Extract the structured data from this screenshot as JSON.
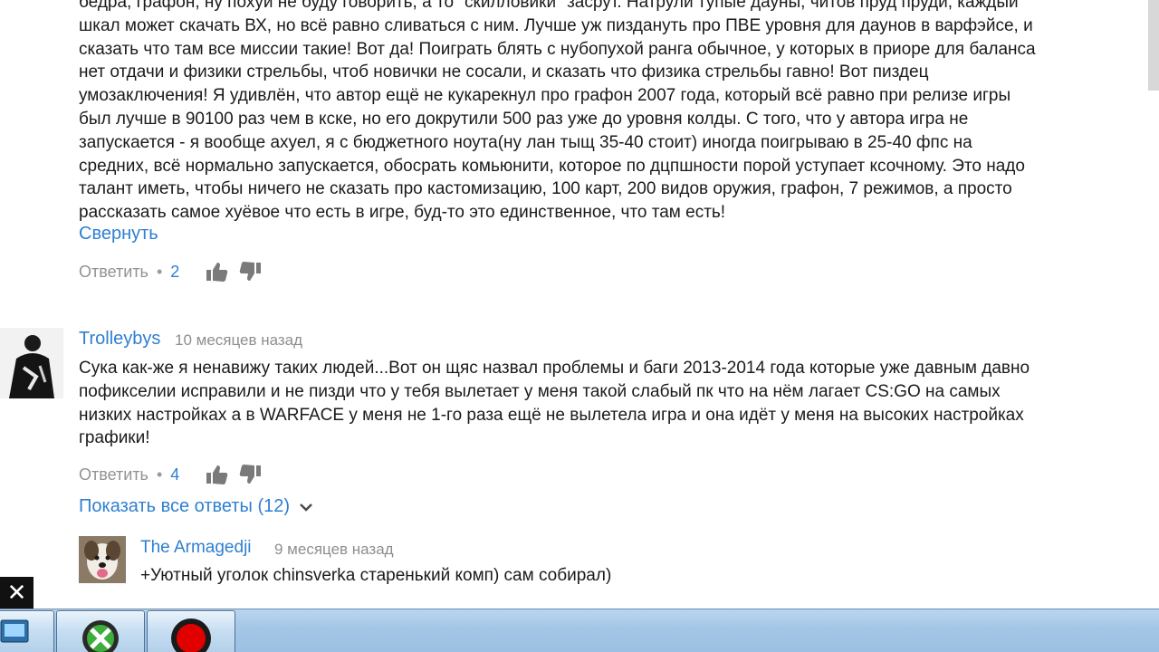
{
  "comment1": {
    "text": "бедра, графон, ну похуй не буду говорить, а то \"скилловики\" засрут. Натрули тупые дауны, читов пруд пруди, каждый\nшкал может скачать ВХ, но всё равно сливаться с ним. Лучше уж пиздануть про ПВЕ уровня для даунов в варфэйсе, и\nсказать что там все миссии такие! Вот да! Поиграть блять с нубопухой ранга обычное, у которых в приоре для баланса\nнет отдачи и физики стрельбы, чтоб новички не сосали, и сказать что физика стрельбы гавно! Вот пиздец\nумозаключения! Я удивлён, что автор ещё не кукарекнул про графон 2007 года, который всё равно при релизе игры\nбыл лучше в 90100 раз чем в кске, но его докрутили 500 раз уже до уровня колды. С того, что у автора игра не\nзапускается - я вообще ахуел, я с бюджетного ноута(ну лан тыщ 35-40 стоит) иногда поигрываю в 25-40 фпс на\nсредних, всё нормально запускается, обосрать комьюнити, которое по дцпшности порой уступает ксочному. Это надо\nталант иметь, чтобы ничего не сказать про кастомизацию, 100 карт, 200 видов оружия, графон, 7 режимов, а просто\nрассказать самое хуёвое что есть в игре, буд-то это единственное, что там есть!",
    "collapse_label": "Свернуть",
    "reply_label": "Ответить",
    "separator": "•",
    "likes": "2"
  },
  "comment2": {
    "author": "Trolleybys",
    "time": "10 месяцев назад",
    "text": "Сука как-же я ненавижу таких людей...Вот он щяс назвал проблемы и баги 2013-2014 года которые уже давным давно\nпофикселии исправили и не пизди что у тебя вылетает у меня такой слабый пк что на нём лагает CS:GO на самых\nнизких настройках а в WARFACE у меня не 1-го раза ещё не вылетела игра и она идёт  у меня на высоких настройках\nграфики!",
    "reply_label": "Ответить",
    "separator": "•",
    "likes": "4",
    "show_replies_label": "Показать все ответы (12)"
  },
  "reply1": {
    "author": "The Armagedji",
    "time": "9 месяцев назад",
    "text": "+Уютный уголок chinsverka старенький комп) сам собирал)"
  },
  "overlay": {
    "close_glyph": "✕"
  },
  "icons": {
    "like": "thumbs-up-icon",
    "dislike": "thumbs-down-icon",
    "chevron": "chevron-down-icon",
    "record": "record-icon"
  },
  "colors": {
    "link": "#2f7fd1",
    "text": "#1b1b1b",
    "muted": "#909090",
    "taskbar": "#a3c6e6",
    "record": "#e10000"
  }
}
